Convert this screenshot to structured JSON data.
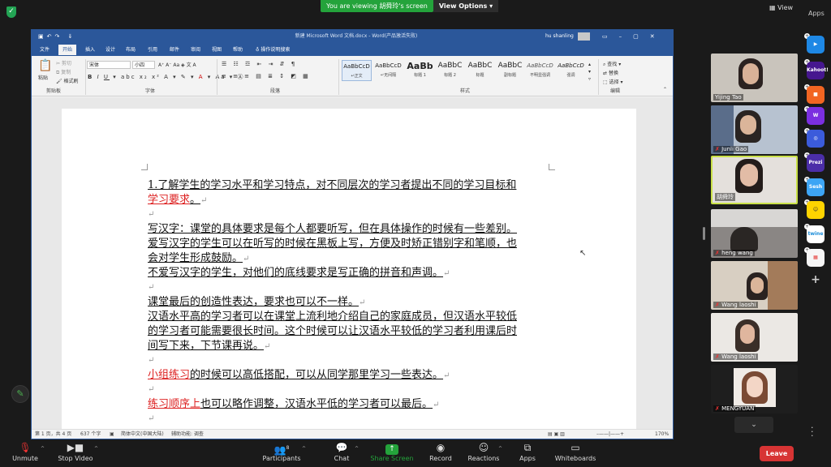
{
  "topbar": {
    "viewing_text": "You are viewing 胡舜玲's screen",
    "view_options": "View Options",
    "view_button": "View",
    "apps_button": "Apps"
  },
  "word": {
    "window_title": "新建 Microsoft Word 文档.docx - Word(产品激活失败)",
    "user_name": "hu shanling",
    "tabs": [
      "文件",
      "开始",
      "插入",
      "设计",
      "布局",
      "引用",
      "邮件",
      "审阅",
      "视图",
      "帮助",
      "操作说明搜索"
    ],
    "active_tab": "开始",
    "clipboard": {
      "paste": "粘贴",
      "cut": "剪切",
      "copy": "复制",
      "format_painter": "格式刷",
      "group": "剪贴板"
    },
    "font": {
      "name": "宋体",
      "size": "小四",
      "group": "字体"
    },
    "paragraph_group": "段落",
    "styles": [
      {
        "preview": "AaBbCcD",
        "label": "↵正文"
      },
      {
        "preview": "AaBbCcD",
        "label": "↵无间隔"
      },
      {
        "preview": "AaBb",
        "label": "标题 1"
      },
      {
        "preview": "AaBbC",
        "label": "标题 2"
      },
      {
        "preview": "AaBbC",
        "label": "标题"
      },
      {
        "preview": "AaBbC",
        "label": "副标题"
      },
      {
        "preview": "AaBbCcD",
        "label": "不明显强调"
      },
      {
        "preview": "AaBbCcD",
        "label": "强调"
      }
    ],
    "styles_group": "样式",
    "editing": {
      "find": "查找",
      "replace": "替换",
      "select": "选择",
      "group": "编辑"
    },
    "status": {
      "page": "第 1 页，共 4 页",
      "words": "637 个字",
      "lang": "简体中文(中国大陆)",
      "accessibility": "辅助功能: 调查",
      "zoom": "170%"
    }
  },
  "document": {
    "p1_l1": "1.了解学生的学习水平和学习特点，对不同层次的学习者提出不同的学习目标和",
    "p1_l2_red": "学习要求",
    "p1_l2_tail": "。",
    "p2_l1": "写汉字：课堂的具体要求是每个人都要听写，但在具体操作的时候有一些差别。",
    "p2_l2": "爱写汉字的学生可以在听写的时候在黑板上写，方便及时矫正错别字和笔顺，也",
    "p2_l3": "会对学生形成鼓励。",
    "p2_l4": "不爱写汉字的学生，对他们的底线要求是写正确的拼音和声调。",
    "p3_l1": "课堂最后的创造性表达，要求也可以不一样。",
    "p3_l2": "汉语水平高的学习者可以在课堂上流利地介绍自己的家庭成员，但汉语水平较低",
    "p3_l3": "的学习者可能需要很长时间。这个时候可以让汉语水平较低的学习者利用课后时",
    "p3_l4": "间写下来，下节课再说。",
    "p4_red": "小组练习",
    "p4_tail": "的时候可以高低搭配，可以从同学那里学习一些表达。",
    "p5_red": "练习顺序上",
    "p5_tail": "也可以略作调整，汉语水平低的学习者可以最后。",
    "mark": "↵"
  },
  "participants": [
    {
      "name": "Yijing Tao"
    },
    {
      "name": "Junli Gao"
    },
    {
      "name": "胡舜玲"
    },
    {
      "name": "heng wang"
    },
    {
      "name": "Wang laoshi"
    },
    {
      "name": "Wang laoshi"
    },
    {
      "name": "MENGYUAN"
    }
  ],
  "apps": [
    "Kahoot!",
    "Prezi",
    "Sesh",
    "twine"
  ],
  "toolbar": {
    "unmute": "Unmute",
    "stop_video": "Stop Video",
    "participants": "Participants",
    "participants_count": "8",
    "chat": "Chat",
    "share_screen": "Share Screen",
    "record": "Record",
    "reactions": "Reactions",
    "apps": "Apps",
    "whiteboards": "Whiteboards",
    "leave": "Leave"
  },
  "colors": {
    "word_blue": "#2b579a",
    "zoom_green": "#24a33b",
    "leave_red": "#d73434",
    "text_red": "#dd2222"
  }
}
